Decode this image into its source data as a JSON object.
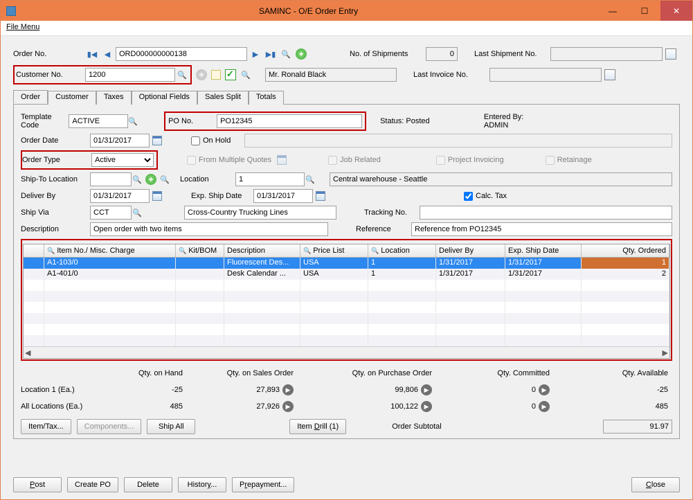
{
  "window": {
    "title": "SAMINC - O/E Order Entry"
  },
  "menu": {
    "file": "File Menu"
  },
  "header": {
    "order_no_label": "Order No.",
    "order_no": "ORD000000000138",
    "no_shipments_label": "No. of Shipments",
    "no_shipments": "0",
    "last_shipment_label": "Last Shipment No.",
    "last_shipment": "",
    "customer_no_label": "Customer No.",
    "customer_no": "1200",
    "customer_name": "Mr. Ronald Black",
    "last_invoice_label": "Last Invoice No.",
    "last_invoice": ""
  },
  "tabs": [
    "Order",
    "Customer",
    "Taxes",
    "Optional Fields",
    "Sales Split",
    "Totals"
  ],
  "order_tab": {
    "template_label": "Template Code",
    "template": "ACTIVE",
    "po_label": "PO No.",
    "po": "PO12345",
    "status_label": "Status: Posted",
    "entered_label": "Entered By: ADMIN",
    "order_date_label": "Order Date",
    "order_date": "01/31/2017",
    "on_hold_label": "On Hold",
    "order_type_label": "Order Type",
    "order_type": "Active",
    "from_quotes_label": "From Multiple Quotes",
    "job_related_label": "Job Related",
    "project_inv_label": "Project Invoicing",
    "retainage_label": "Retainage",
    "shipto_label": "Ship-To Location",
    "shipto": "",
    "location_label": "Location",
    "location": "1",
    "location_desc": "Central warehouse - Seattle",
    "deliver_by_label": "Deliver By",
    "deliver_by": "01/31/2017",
    "exp_ship_label": "Exp. Ship Date",
    "exp_ship": "01/31/2017",
    "calc_tax_label": "Calc. Tax",
    "ship_via_label": "Ship Via",
    "ship_via": "CCT",
    "ship_via_desc": "Cross-Country Trucking Lines",
    "tracking_label": "Tracking No.",
    "tracking": "",
    "description_label": "Description",
    "description": "Open order with two items",
    "reference_label": "Reference",
    "reference": "Reference from PO12345"
  },
  "grid": {
    "cols": [
      "",
      "Item No./ Misc. Charge",
      "Kit/BOM",
      "Description",
      "Price List",
      "Location",
      "Deliver By",
      "Exp. Ship Date",
      "Qty. Ordered"
    ],
    "rows": [
      {
        "item": "A1-103/0",
        "kit": "",
        "desc": "Fluorescent Des...",
        "price": "USA",
        "loc": "1",
        "deliver": "1/31/2017",
        "ship": "1/31/2017",
        "qty": "1",
        "selected": true
      },
      {
        "item": "A1-401/0",
        "kit": "",
        "desc": "Desk Calendar ...",
        "price": "USA",
        "loc": "1",
        "deliver": "1/31/2017",
        "ship": "1/31/2017",
        "qty": "2",
        "selected": false
      }
    ]
  },
  "stats": {
    "headers": [
      "Qty. on Hand",
      "Qty. on Sales Order",
      "Qty. on Purchase Order",
      "Qty. Committed",
      "Qty. Available"
    ],
    "row1_label": "Location  1 (Ea.)",
    "row1": [
      "-25",
      "27,893",
      "99,806",
      "0",
      "-25"
    ],
    "row2_label": "All Locations (Ea.)",
    "row2": [
      "485",
      "27,926",
      "100,122",
      "0",
      "485"
    ]
  },
  "buttons": {
    "item_tax": "Item/Tax...",
    "components": "Components...",
    "ship_all": "Ship All",
    "item_drill": "Item Drill (1)",
    "subtotal_label": "Order Subtotal",
    "subtotal": "91.97",
    "post": "Post",
    "create_po": "Create PO",
    "delete": "Delete",
    "history": "History...",
    "prepayment": "Prepayment...",
    "close": "Close"
  }
}
